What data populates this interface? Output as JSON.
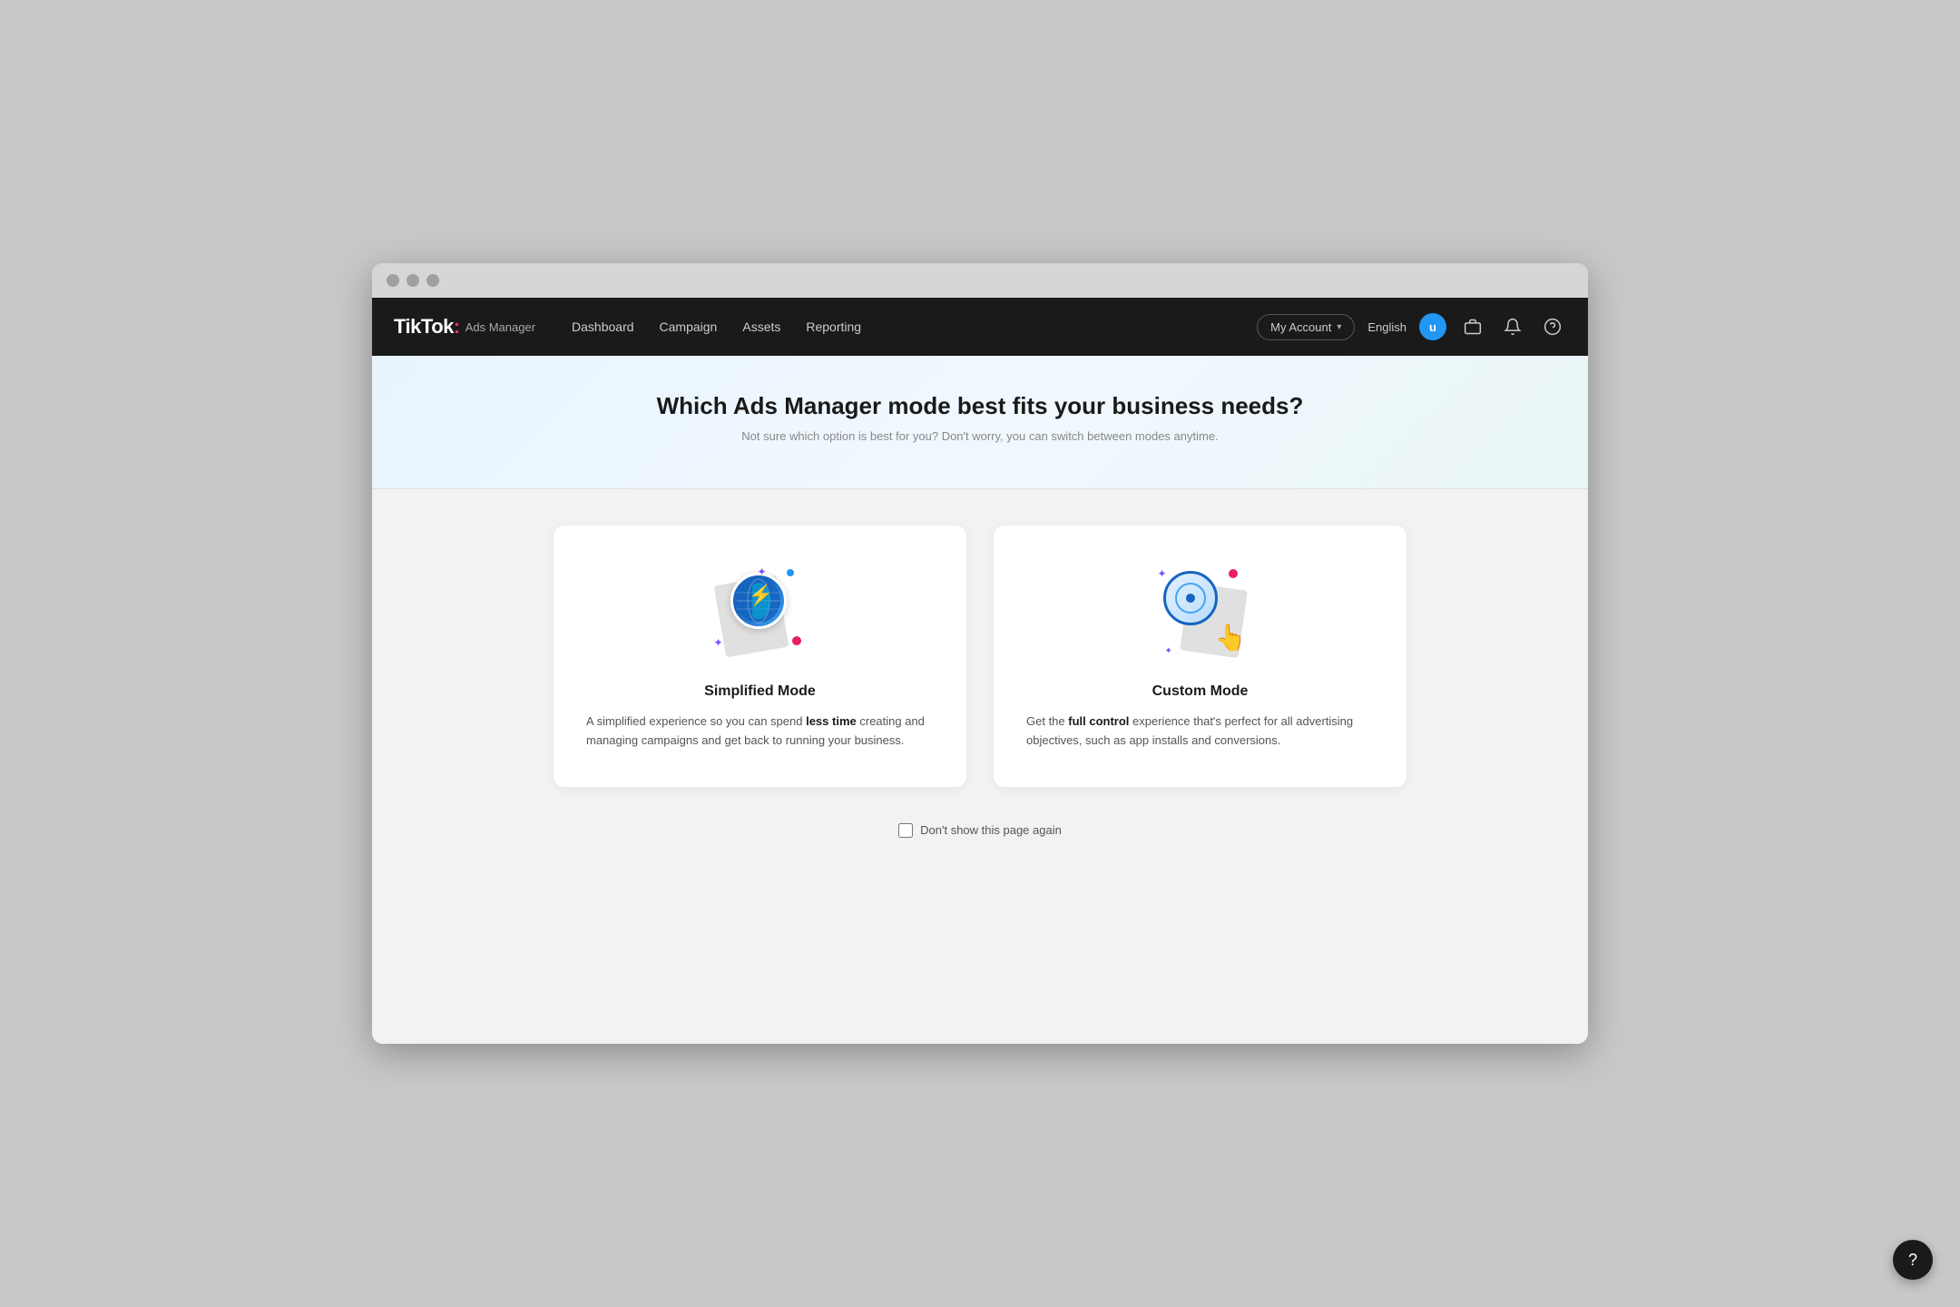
{
  "browser": {
    "traffic_lights": [
      "close",
      "minimize",
      "maximize"
    ]
  },
  "navbar": {
    "logo_brand": "TikTok",
    "logo_colon": ":",
    "logo_product": "Ads Manager",
    "nav_items": [
      {
        "label": "Dashboard",
        "id": "dashboard"
      },
      {
        "label": "Campaign",
        "id": "campaign"
      },
      {
        "label": "Assets",
        "id": "assets"
      },
      {
        "label": "Reporting",
        "id": "reporting"
      }
    ],
    "my_account_label": "My Account",
    "language_label": "English",
    "user_initial": "u"
  },
  "hero": {
    "title": "Which Ads Manager mode best fits your business needs?",
    "subtitle": "Not sure which option is best for you? Don't worry, you can switch between modes anytime."
  },
  "cards": [
    {
      "id": "simplified",
      "title": "Simplified Mode",
      "desc_before": "A simplified experience so you can spend ",
      "desc_bold": "less time",
      "desc_after": " creating and managing campaigns and get back to running your business."
    },
    {
      "id": "custom",
      "title": "Custom Mode",
      "desc_before": "Get the ",
      "desc_bold": "full control",
      "desc_after": " experience that's perfect for all advertising objectives, such as app installs and conversions."
    }
  ],
  "footer_checkbox": {
    "label": "Don't show this page again"
  },
  "help_fab": {
    "icon": "?"
  }
}
